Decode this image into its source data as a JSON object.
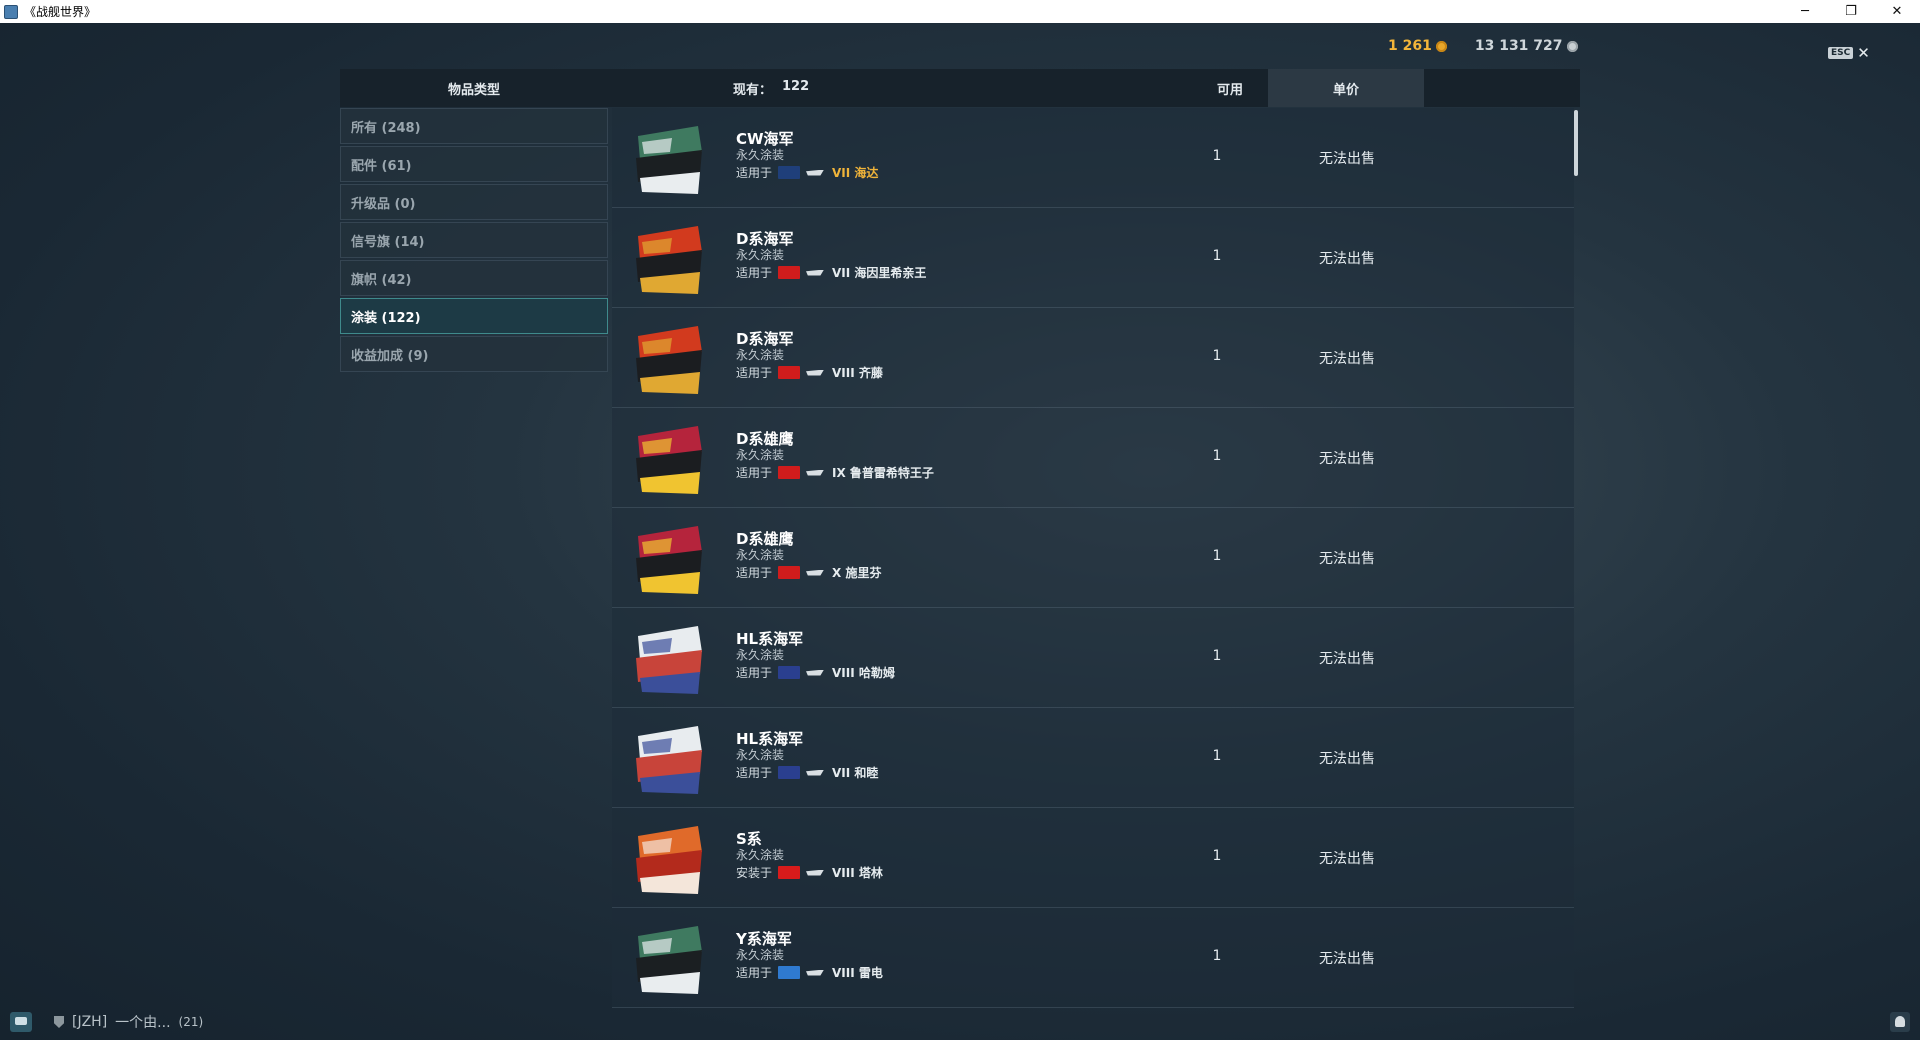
{
  "window": {
    "title": "《战舰世界》",
    "minimize": "─",
    "restore": "❐",
    "close": "✕"
  },
  "currency": {
    "gold": "1 261",
    "silver": "13 131 727"
  },
  "esc": {
    "key": "ESC",
    "close": "✕"
  },
  "header": {
    "type_label": "物品类型",
    "count_label": "现有：",
    "count_value": "122",
    "available_label": "可用",
    "price_label": "单价"
  },
  "sidebar": {
    "items": [
      {
        "label": "所有 (248)"
      },
      {
        "label": "配件 (61)"
      },
      {
        "label": "升级品 (0)"
      },
      {
        "label": "信号旗 (14)"
      },
      {
        "label": "旗帜 (42)"
      },
      {
        "label": "涂装 (122)"
      },
      {
        "label": "收益加成 (9)"
      }
    ],
    "active_index": 5
  },
  "items": [
    {
      "name": "CW海军",
      "sub": "永久涂装",
      "applies_label": "适用于",
      "ship": "VII 海达",
      "ship_color": "#f0b43a",
      "flag": "#1f3f7a",
      "thumb": [
        "#3f7a60",
        "#1b1f22",
        "#e9edef"
      ]
    },
    {
      "name": "D系海军",
      "sub": "永久涂装",
      "applies_label": "适用于",
      "ship": "VII 海因里希亲王",
      "ship_color": "#e6ecef",
      "flag": "#d01c1c",
      "thumb": [
        "#d23a1e",
        "#1b1d20",
        "#e0a832"
      ]
    },
    {
      "name": "D系海军",
      "sub": "永久涂装",
      "applies_label": "适用于",
      "ship": "VIII 齐藤",
      "ship_color": "#e6ecef",
      "flag": "#d01c1c",
      "thumb": [
        "#d23a1e",
        "#1b1d20",
        "#e0a832"
      ]
    },
    {
      "name": "D系雄鹰",
      "sub": "永久涂装",
      "applies_label": "适用于",
      "ship": "IX 鲁普雷希特王子",
      "ship_color": "#e6ecef",
      "flag": "#d01c1c",
      "thumb": [
        "#b5243c",
        "#1b1d20",
        "#f0c430"
      ]
    },
    {
      "name": "D系雄鹰",
      "sub": "永久涂装",
      "applies_label": "适用于",
      "ship": "X 施里芬",
      "ship_color": "#e6ecef",
      "flag": "#d01c1c",
      "thumb": [
        "#b5243c",
        "#1b1d20",
        "#f0c430"
      ]
    },
    {
      "name": "HL系海军",
      "sub": "永久涂装",
      "applies_label": "适用于",
      "ship": "VIII 哈勒姆",
      "ship_color": "#e6ecef",
      "flag": "#2a3f8f",
      "thumb": [
        "#e8ecef",
        "#c8443a",
        "#3b4f9a"
      ]
    },
    {
      "name": "HL系海军",
      "sub": "永久涂装",
      "applies_label": "适用于",
      "ship": "VII 和睦",
      "ship_color": "#e6ecef",
      "flag": "#2a3f8f",
      "thumb": [
        "#e8ecef",
        "#c8443a",
        "#3b4f9a"
      ]
    },
    {
      "name": "S系",
      "sub": "永久涂装",
      "applies_label": "安装于",
      "ship": "VIII 塔林",
      "ship_color": "#e6ecef",
      "flag": "#d81b1b",
      "thumb": [
        "#e06a2a",
        "#b32a1c",
        "#f4e6da"
      ]
    },
    {
      "name": "Y系海军",
      "sub": "永久涂装",
      "applies_label": "适用于",
      "ship": "VIII 雷电",
      "ship_color": "#e6ecef",
      "flag": "#2f7ad0",
      "thumb": [
        "#3f7a60",
        "#1b1f22",
        "#e9edef"
      ]
    }
  ],
  "available_value": "1",
  "price_value": "无法出售",
  "bottom": {
    "clan": "[JZH]",
    "clan_name": "一个由...",
    "clan_count": "(21)"
  }
}
